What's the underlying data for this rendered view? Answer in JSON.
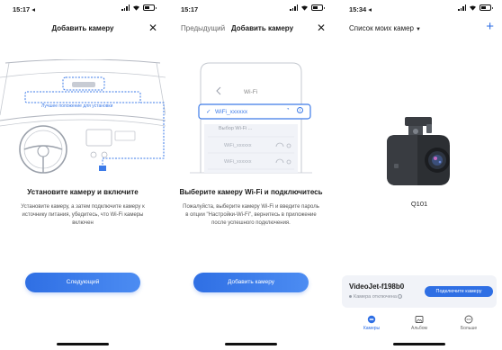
{
  "screens": [
    {
      "status_time": "15:17 ◂",
      "title": "Добавить камеру",
      "illustration_label": "Лучшее положение для установки",
      "step_title": "Установите камеру и включите",
      "step_desc": "Установите камеру, а затем подключите камеру к источнику питания, убедитесь, что Wi-Fi камеры включен",
      "button_label": "Следующий"
    },
    {
      "status_time": "15:17",
      "prev_label": "Предыдущий",
      "title": "Добавить камеру",
      "wifi_header": "Wi-Fi",
      "selected_network": "WiFi_xxxxxx",
      "choose_label": "Выбор Wi-Fi ...",
      "other_network_1": "WiFi_xxxxxx",
      "other_network_2": "WiFi_xxxxxx",
      "step_title": "Выберите камеру Wi-Fi и подключитесь",
      "step_desc": "Пожалуйста, выберите камеру Wi-Fi и введите пароль в опции \"Настройки-Wi-Fi\", вернитесь в приложение после успешного подключения.",
      "button_label": "Добавить камеру"
    },
    {
      "status_time": "15:34 ◂",
      "list_title": "Список моих камер",
      "add_symbol": "+",
      "model": "Q101",
      "camera_name": "VideoJet-f198b0",
      "camera_status": "Камера отключена",
      "connect_label": "Подключите камеру",
      "tabs": [
        {
          "label": "Камеры",
          "active": true
        },
        {
          "label": "Альбом",
          "active": false
        },
        {
          "label": "Больше",
          "active": false
        }
      ]
    }
  ],
  "colors": {
    "accent": "#2f6fe4",
    "dashed_line": "#3d7be8",
    "card_bg": "#f1f3f8"
  }
}
